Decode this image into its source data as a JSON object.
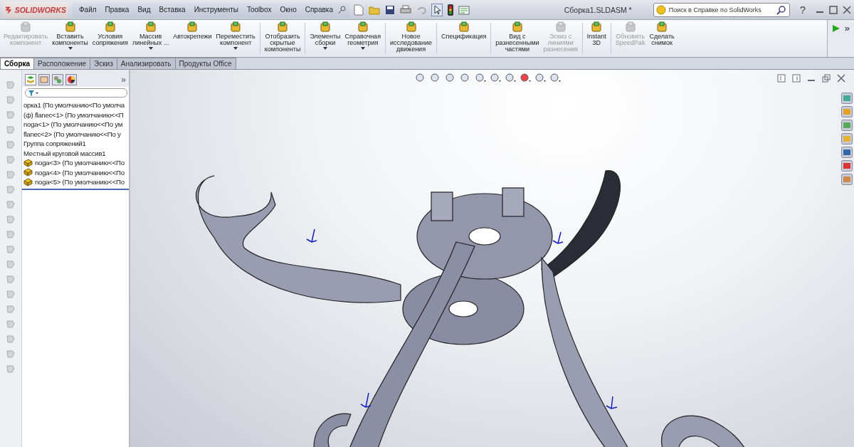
{
  "app": {
    "logo": "SOLIDWORKS"
  },
  "menu": [
    "Файл",
    "Правка",
    "Вид",
    "Вставка",
    "Инструменты",
    "Toolbox",
    "Окно",
    "Справка"
  ],
  "document_title": "Сборка1.SLDASM *",
  "search": {
    "placeholder": "Поиск в Справке по SolidWorks"
  },
  "help": "?",
  "ribbon_groups": [
    {
      "buttons": [
        {
          "label": "Редактировать\nкомпонент",
          "disabled": true,
          "dropdown": false
        },
        {
          "label": "Вставить\nкомпоненты",
          "disabled": false,
          "dropdown": true
        },
        {
          "label": "Условия\nсопряжения",
          "disabled": false,
          "dropdown": false
        },
        {
          "label": "Массив\nлинейных ...",
          "disabled": false,
          "dropdown": true
        },
        {
          "label": "Автокрепежи",
          "disabled": false,
          "dropdown": false
        },
        {
          "label": "Переместить\nкомпонент",
          "disabled": false,
          "dropdown": true
        }
      ]
    },
    {
      "buttons": [
        {
          "label": "Отобразить\nскрытые\nкомпоненты",
          "disabled": false,
          "dropdown": false
        }
      ]
    },
    {
      "buttons": [
        {
          "label": "Элементы\nсборки",
          "disabled": false,
          "dropdown": true
        },
        {
          "label": "Справочная\nгеометрия",
          "disabled": false,
          "dropdown": true
        }
      ]
    },
    {
      "buttons": [
        {
          "label": "Новое\nисследование\nдвижения",
          "disabled": false,
          "dropdown": false
        }
      ]
    },
    {
      "buttons": [
        {
          "label": "Спецификация",
          "disabled": false,
          "dropdown": false
        }
      ]
    },
    {
      "buttons": [
        {
          "label": "Вид с\nразнесенными\nчастями",
          "disabled": false,
          "dropdown": false
        },
        {
          "label": "Эскиз с\nлиниями\nразнесения",
          "disabled": true,
          "dropdown": false
        }
      ]
    },
    {
      "buttons": [
        {
          "label": "Instant\n3D",
          "disabled": false,
          "dropdown": false
        }
      ]
    },
    {
      "buttons": [
        {
          "label": "Обновить\nSpeedPak",
          "disabled": true,
          "dropdown": false
        },
        {
          "label": "Сделать\nснимок",
          "disabled": false,
          "dropdown": false
        }
      ]
    }
  ],
  "ribbon_overflow": "»",
  "tabs": [
    {
      "label": "Сборка",
      "selected": true
    },
    {
      "label": "Расположение",
      "selected": false
    },
    {
      "label": "Эскиз",
      "selected": false
    },
    {
      "label": "Анализировать",
      "selected": false
    },
    {
      "label": "Продукты Office",
      "selected": false
    }
  ],
  "panel_overflow": "»",
  "tree": [
    {
      "text": "орка1  (По умолчанию<По умолча",
      "kind": "plain"
    },
    {
      "text": "(ф) flanec<1> (По умолчанию<<П",
      "kind": "plain"
    },
    {
      "text": "noga<1> (По умолчанию<<По ум",
      "kind": "plain"
    },
    {
      "text": "flanec<2> (По умолчанию<<По у",
      "kind": "plain"
    },
    {
      "text": "Группа сопряжений1",
      "kind": "plain"
    },
    {
      "text": "Местный круговой массив1",
      "kind": "plain"
    },
    {
      "text": "noga<3> (По умолчанию<<По",
      "kind": "part"
    },
    {
      "text": "noga<4> (По умолчанию<<По",
      "kind": "part"
    },
    {
      "text": "noga<5> (По умолчанию<<По",
      "kind": "part"
    }
  ]
}
